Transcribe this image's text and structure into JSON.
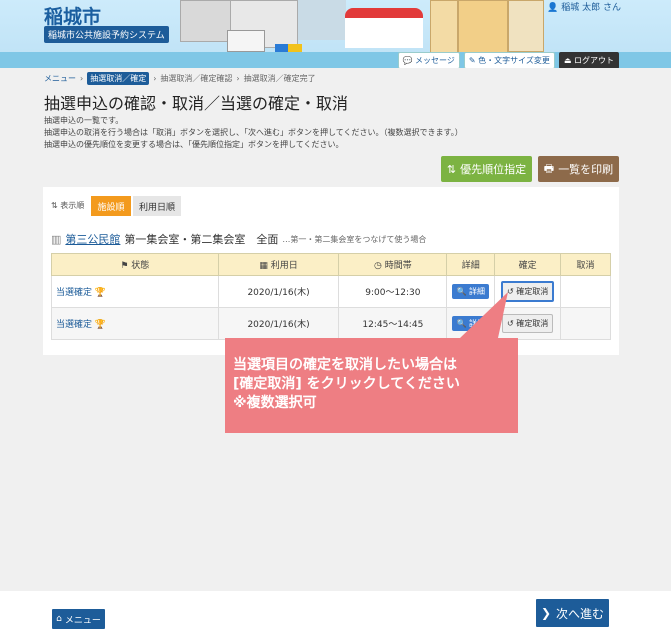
{
  "header": {
    "city": "稲城市",
    "system": "稲城市公共施設予約システム",
    "user": "稲城 太郎 さん",
    "buttons": [
      "メッセージ",
      "色・文字サイズ変更",
      "ログアウト"
    ]
  },
  "breadcrumb": {
    "menu": "メニュー",
    "current": "抽選取消／確定",
    "step2": "抽選取消／確定確認",
    "step3": "抽選取消／確定完了"
  },
  "page": {
    "title": "抽選申込の確認・取消／当選の確定・取消",
    "desc1": "抽選申込の一覧です。",
    "desc2": "抽選申込の取消を行う場合は「取消」ボタンを選択し、「次へ進む」ボタンを押してください。（複数選択できます。）",
    "desc3": "抽選申込の優先順位を変更する場合は、「優先順位指定」ボタンを押してください。"
  },
  "actions": {
    "priority": "優先順位指定",
    "print": "一覧を印刷"
  },
  "sort": {
    "label": "表示順",
    "by_facility": "施設順",
    "by_date": "利用日順"
  },
  "facility": {
    "name": "第三公民館",
    "room": "第一集会室・第二集会室　全面",
    "note": "…第一・第二集会室をつなげて使う場合"
  },
  "table": {
    "headers": [
      "状態",
      "利用日",
      "時間帯",
      "詳細",
      "確定",
      "取消"
    ],
    "rows": [
      {
        "status": "当選確定",
        "date": "2020/1/16(木)",
        "time": "9:00～12:30",
        "detail": "詳細",
        "confirm": "確定取消"
      },
      {
        "status": "当選確定",
        "date": "2020/1/16(木)",
        "time": "12:45～14:45",
        "detail": "詳細",
        "confirm": "確定取消"
      }
    ]
  },
  "callout": {
    "line1": "当選項目の確定を取消したい場合は",
    "line2": "[確定取消] をクリックしてください",
    "line3": "※複数選択可"
  },
  "footer": {
    "menu": "メニュー",
    "next": "次へ進む"
  }
}
